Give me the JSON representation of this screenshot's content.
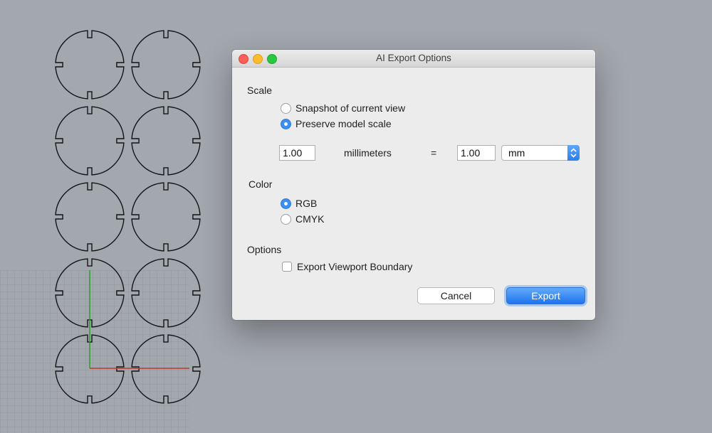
{
  "dialog": {
    "title": "AI Export Options",
    "scale": {
      "label": "Scale",
      "options": [
        {
          "label": "Snapshot of current view",
          "selected": false
        },
        {
          "label": "Preserve model scale",
          "selected": true
        }
      ],
      "left_value": "1.00",
      "left_unit": "millimeters",
      "equals": "=",
      "right_value": "1.00",
      "unit_select": "mm"
    },
    "color": {
      "label": "Color",
      "options": [
        {
          "label": "RGB",
          "selected": true
        },
        {
          "label": "CMYK",
          "selected": false
        }
      ]
    },
    "options": {
      "label": "Options",
      "export_viewport_boundary": {
        "label": "Export Viewport Boundary",
        "checked": false
      }
    },
    "buttons": {
      "cancel": "Cancel",
      "export": "Export"
    }
  },
  "viewport": {
    "background_color": "#a3a7ae",
    "grid_color": "#8e9299",
    "curve_color": "#141414",
    "x_axis_color": "#c0392b",
    "y_axis_color": "#27a327",
    "part_count": 10,
    "part_columns": 2,
    "part_rows": 5
  },
  "accent_color": "#3b8ef3"
}
